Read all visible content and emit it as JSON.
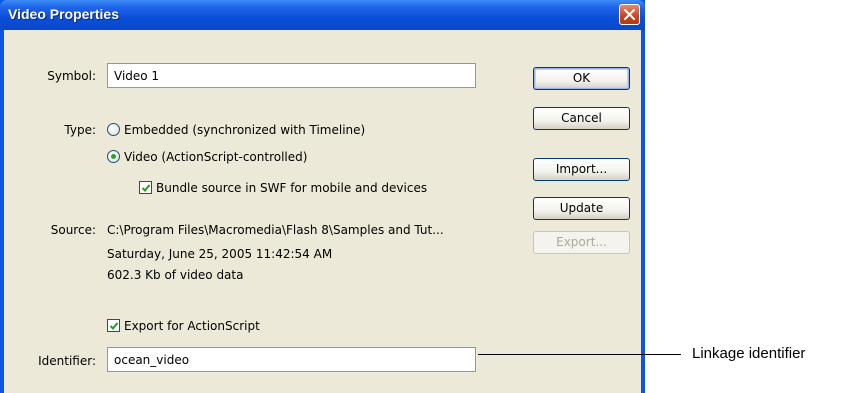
{
  "window": {
    "title": "Video Properties",
    "close_icon": "close-icon"
  },
  "symbol": {
    "label": "Symbol:",
    "value": "Video 1"
  },
  "type": {
    "label": "Type:",
    "options": [
      {
        "label": "Embedded (synchronized with Timeline)",
        "selected": false
      },
      {
        "label": "Video (ActionScript-controlled)",
        "selected": true
      }
    ],
    "bundle": {
      "label": "Bundle source in SWF for mobile and devices",
      "checked": true
    }
  },
  "source": {
    "label": "Source:",
    "path": "C:\\Program Files\\Macromedia\\Flash 8\\Samples and Tut...",
    "date": "Saturday, June 25, 2005  11:42:54 AM",
    "size": "602.3 Kb of video data"
  },
  "export_actionscript": {
    "label": "Export for ActionScript",
    "checked": true
  },
  "identifier": {
    "label": "Identifier:",
    "value": "ocean_video"
  },
  "buttons": {
    "ok": "OK",
    "cancel": "Cancel",
    "import": "Import...",
    "update": "Update",
    "export": "Export..."
  },
  "callout": {
    "text": "Linkage identifier"
  },
  "colors": {
    "title_bar": "#0b4fd8",
    "dialog_bg": "#ece9d8",
    "radio_selected": "#2ba32b",
    "checkmark": "#21a121",
    "disabled_text": "#aca899"
  }
}
